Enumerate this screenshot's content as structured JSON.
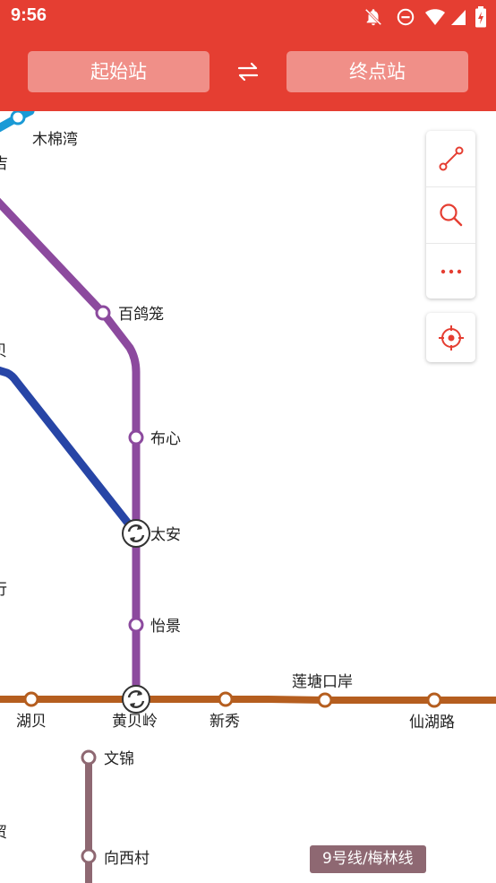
{
  "status_bar": {
    "time": "9:56",
    "icons": [
      "bell-off-icon",
      "do-not-disturb-icon",
      "wifi-icon",
      "signal-icon",
      "battery-charging-icon"
    ]
  },
  "header": {
    "start_placeholder": "起始站",
    "end_placeholder": "终点站",
    "swap_icon": "swap-icon"
  },
  "toolbar": {
    "icons": [
      "route-icon",
      "search-icon",
      "more-icon"
    ],
    "locate_icon": "locate-icon"
  },
  "colors": {
    "accent": "#e53e32",
    "line_blue_light": "#1a9ad6",
    "line_purple": "#8c4a9e",
    "line_blue_dark": "#2745a6",
    "line_brown": "#b55e1f",
    "line_mauve": "#8e6872"
  },
  "map": {
    "stations": {
      "mumianwan": "木棉湾",
      "baigelong": "百鸽笼",
      "buxin": "布心",
      "taian": "太安",
      "yijing": "怡景",
      "hubei": "湖贝",
      "huangbeiling": "黄贝岭",
      "xinxiu": "新秀",
      "liantangkouan": "莲塘口岸",
      "xianhulu": "仙湖路",
      "wenjin": "文锦",
      "xiangxicun": "向西村"
    },
    "partial_labels": {
      "a": "吉",
      "b": "贝",
      "c": "行",
      "d": "贸"
    }
  },
  "line_badge": "9号线/梅林线"
}
